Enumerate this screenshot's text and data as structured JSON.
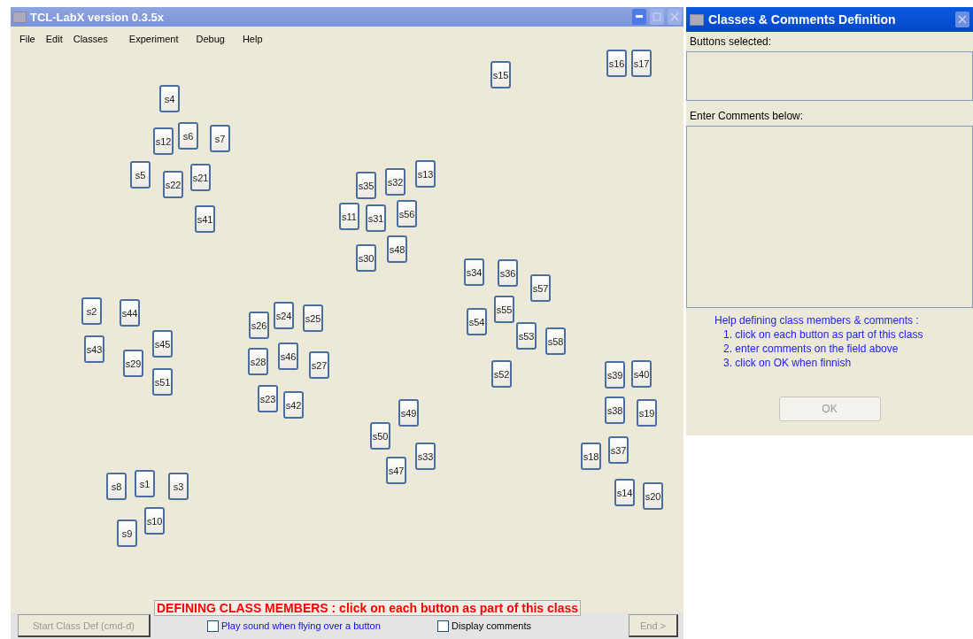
{
  "main_window": {
    "title": "TCL-LabX version 0.3.5x",
    "menu": [
      "File",
      "Edit",
      "Classes",
      "Experiment",
      "Debug",
      "Help"
    ],
    "canvas_buttons": [
      "s4",
      "s12",
      "s6",
      "s7",
      "s5",
      "s22",
      "s21",
      "s41",
      "s15",
      "s16",
      "s17",
      "s35",
      "s32",
      "s13",
      "s11",
      "s31",
      "s56",
      "s30",
      "s48",
      "s34",
      "s36",
      "s57",
      "s55",
      "s54",
      "s53",
      "s58",
      "s52",
      "s2",
      "s44",
      "s43",
      "s45",
      "s29",
      "s51",
      "s26",
      "s24",
      "s25",
      "s28",
      "s46",
      "s27",
      "s23",
      "s42",
      "s49",
      "s50",
      "s33",
      "s47",
      "s39",
      "s40",
      "s38",
      "s19",
      "s37",
      "s18",
      "s14",
      "s20",
      "s8",
      "s1",
      "s3",
      "s10",
      "s9"
    ],
    "status_message": "DEFINING CLASS MEMBERS : click on each button as part of this class",
    "bottom_bar": {
      "start_button": {
        "label": "Start Class Def (cmd-d)",
        "disabled": true
      },
      "play_sound": {
        "label": "Play sound when flying over a button",
        "checked": false
      },
      "display_comments": {
        "label": "Display comments",
        "checked": false
      },
      "end_button": {
        "label": "End >",
        "disabled": true
      }
    }
  },
  "dialog": {
    "title": "Classes & Comments Definition",
    "buttons_selected_label": "Buttons selected:",
    "comments_label": "Enter Comments below:",
    "help_title": "Help defining class members & comments :",
    "help_steps": [
      "1. click on each button as part of this class",
      "2. enter comments on the field above",
      "3. click on OK when finnish"
    ],
    "ok_button": {
      "label": "OK",
      "disabled": true
    }
  }
}
